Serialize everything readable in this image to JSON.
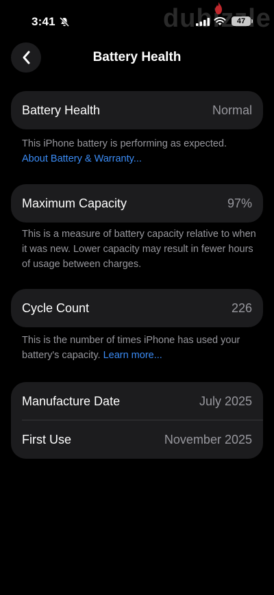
{
  "status": {
    "time": "3:41",
    "battery_level": "47",
    "watermark": "dubizzle"
  },
  "header": {
    "title": "Battery Health"
  },
  "battery_health": {
    "label": "Battery Health",
    "value": "Normal",
    "note": "This iPhone battery is performing as expected.",
    "link": "About Battery & Warranty..."
  },
  "max_capacity": {
    "label": "Maximum Capacity",
    "value": "97%",
    "note": "This is a measure of battery capacity relative to when it was new. Lower capacity may result in fewer hours of usage between charges."
  },
  "cycle_count": {
    "label": "Cycle Count",
    "value": "226",
    "note": "This is the number of times iPhone has used your battery's capacity.",
    "link": "Learn more..."
  },
  "dates": {
    "manufacture_label": "Manufacture Date",
    "manufacture_value": "July 2025",
    "first_use_label": "First Use",
    "first_use_value": "November 2025"
  },
  "colors": {
    "accent": "#3b8cf6",
    "card": "#1c1c1e",
    "secondary_text": "#98989e"
  }
}
